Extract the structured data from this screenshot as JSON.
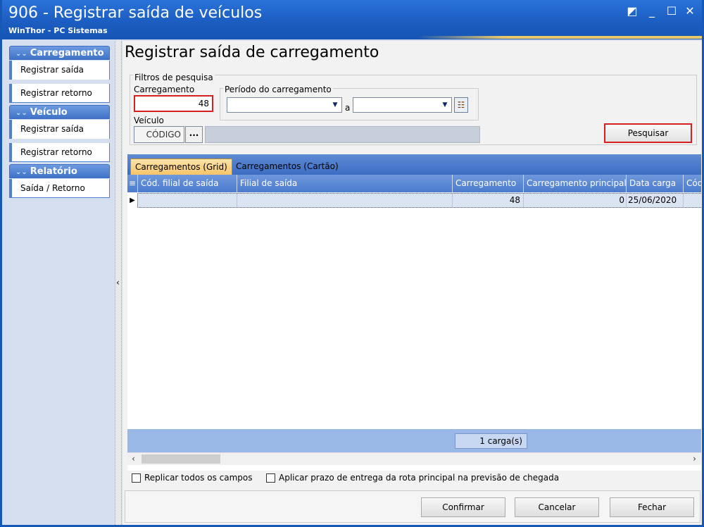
{
  "window": {
    "title": "906 - Registrar saída de veículos",
    "subtitle": "WinThor - PC Sistemas",
    "controls": {
      "restore": "◩",
      "minimize": "_",
      "maximize": "☐",
      "close": "✕"
    }
  },
  "sidebar": {
    "sections": [
      {
        "header": "Carregamento",
        "items": [
          "Registrar saída",
          "Registrar retorno"
        ]
      },
      {
        "header": "Veículo",
        "items": [
          "Registrar saída",
          "Registrar retorno"
        ]
      },
      {
        "header": "Relatório",
        "items": [
          "Saída / Retorno"
        ]
      }
    ]
  },
  "main": {
    "page_title": "Registrar saída de carregamento",
    "filters": {
      "group_label": "Filtros de pesquisa",
      "carregamento_label": "Carregamento",
      "carregamento_value": "48",
      "periodo_label": "Período do carregamento",
      "periodo_from": "",
      "periodo_sep": "a",
      "periodo_to": "",
      "veiculo_label": "Veículo",
      "veiculo_code_placeholder": "CÓDIGO",
      "veiculo_lookup": "...",
      "search_button": "Pesquisar"
    },
    "tabs": [
      {
        "label": "Carregamentos (Grid)",
        "active": true
      },
      {
        "label": "Carregamentos (Cartão)",
        "active": false
      }
    ],
    "grid": {
      "columns": [
        "Cód. filial de saída",
        "Filial de saída",
        "Carregamento",
        "Carregamento principal",
        "Data carga",
        "Cód"
      ],
      "rows": [
        {
          "cod_filial": "",
          "filial": "",
          "carregamento": "48",
          "carregamento_principal": "0",
          "data_carga": "25/06/2020",
          "cod": ""
        }
      ],
      "footer_count": "1 carga(s)"
    },
    "options": {
      "replicar_label": "Replicar todos os campos",
      "replicar_checked": false,
      "aplicar_label": "Aplicar prazo de entrega da rota principal na previsão de chegada",
      "aplicar_checked": false
    },
    "buttons": {
      "confirmar": "Confirmar",
      "cancelar": "Cancelar",
      "fechar": "Fechar"
    }
  },
  "colors": {
    "title_bar": "#1a5cc0",
    "sidebar_header": "#3f73c8",
    "active_tab": "#f7c46a",
    "highlight_border": "#d62020",
    "selected_row": "#dbe4f3"
  }
}
